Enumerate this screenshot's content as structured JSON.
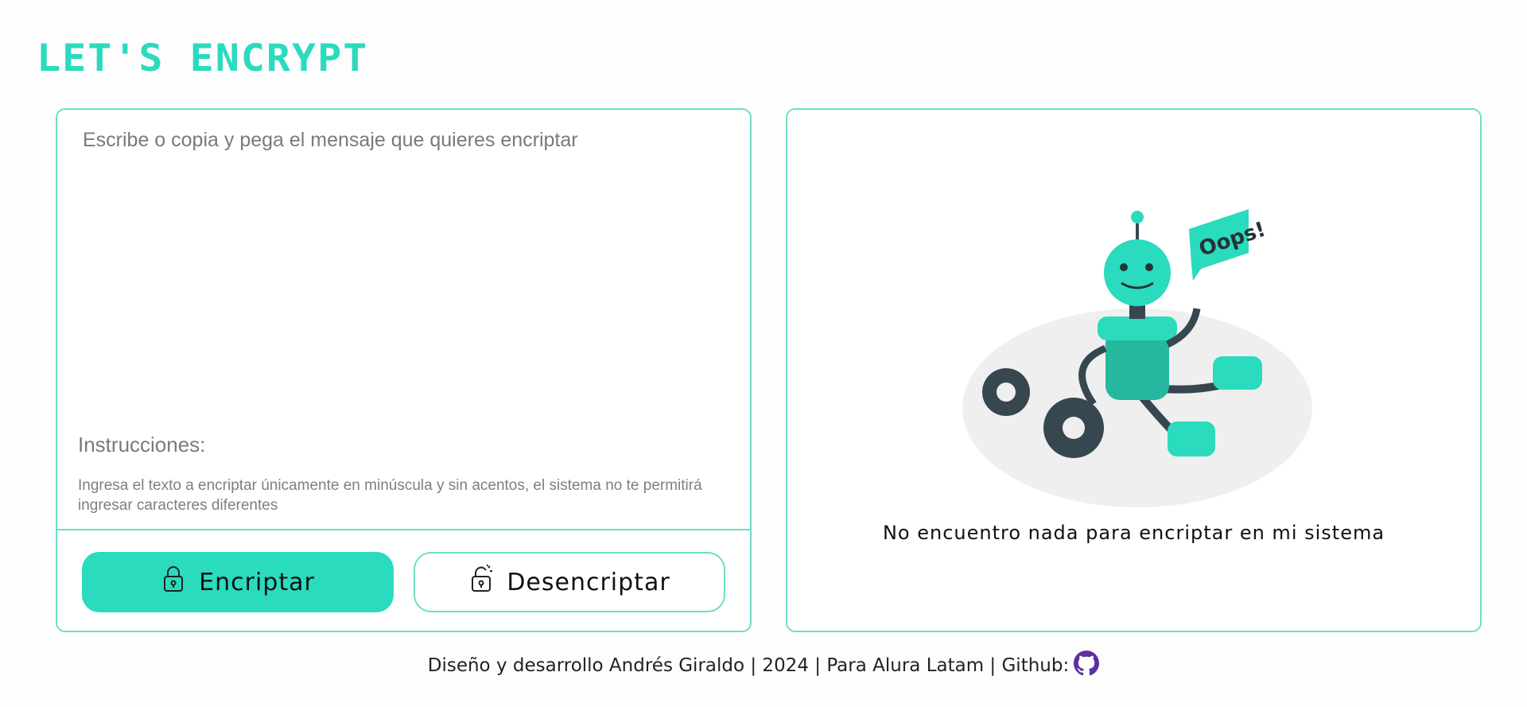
{
  "header": {
    "logo_text": "LET'S ENCRYPT"
  },
  "input_panel": {
    "placeholder": "Escribe o copia y pega el mensaje que quieres encriptar",
    "value": "",
    "instructions_title": "Instrucciones:",
    "instructions_text": "Ingresa el texto a encriptar únicamente en minúscula y sin acentos, el sistema no te permitirá ingresar caracteres diferentes",
    "encrypt_label": "Encriptar",
    "decrypt_label": "Desencriptar"
  },
  "output_panel": {
    "illustration_text": "Oops!",
    "empty_message": "No encuentro nada para encriptar en mi sistema"
  },
  "footer": {
    "text": "Diseño y desarrollo Andrés Giraldo | 2024 | Para Alura Latam | Github:",
    "icon": "github-icon"
  },
  "colors": {
    "accent": "#2adbbe",
    "border": "#6fddc8",
    "text_dark": "#111111",
    "text_muted": "#7a7a7a",
    "github": "#5b2fa0"
  }
}
